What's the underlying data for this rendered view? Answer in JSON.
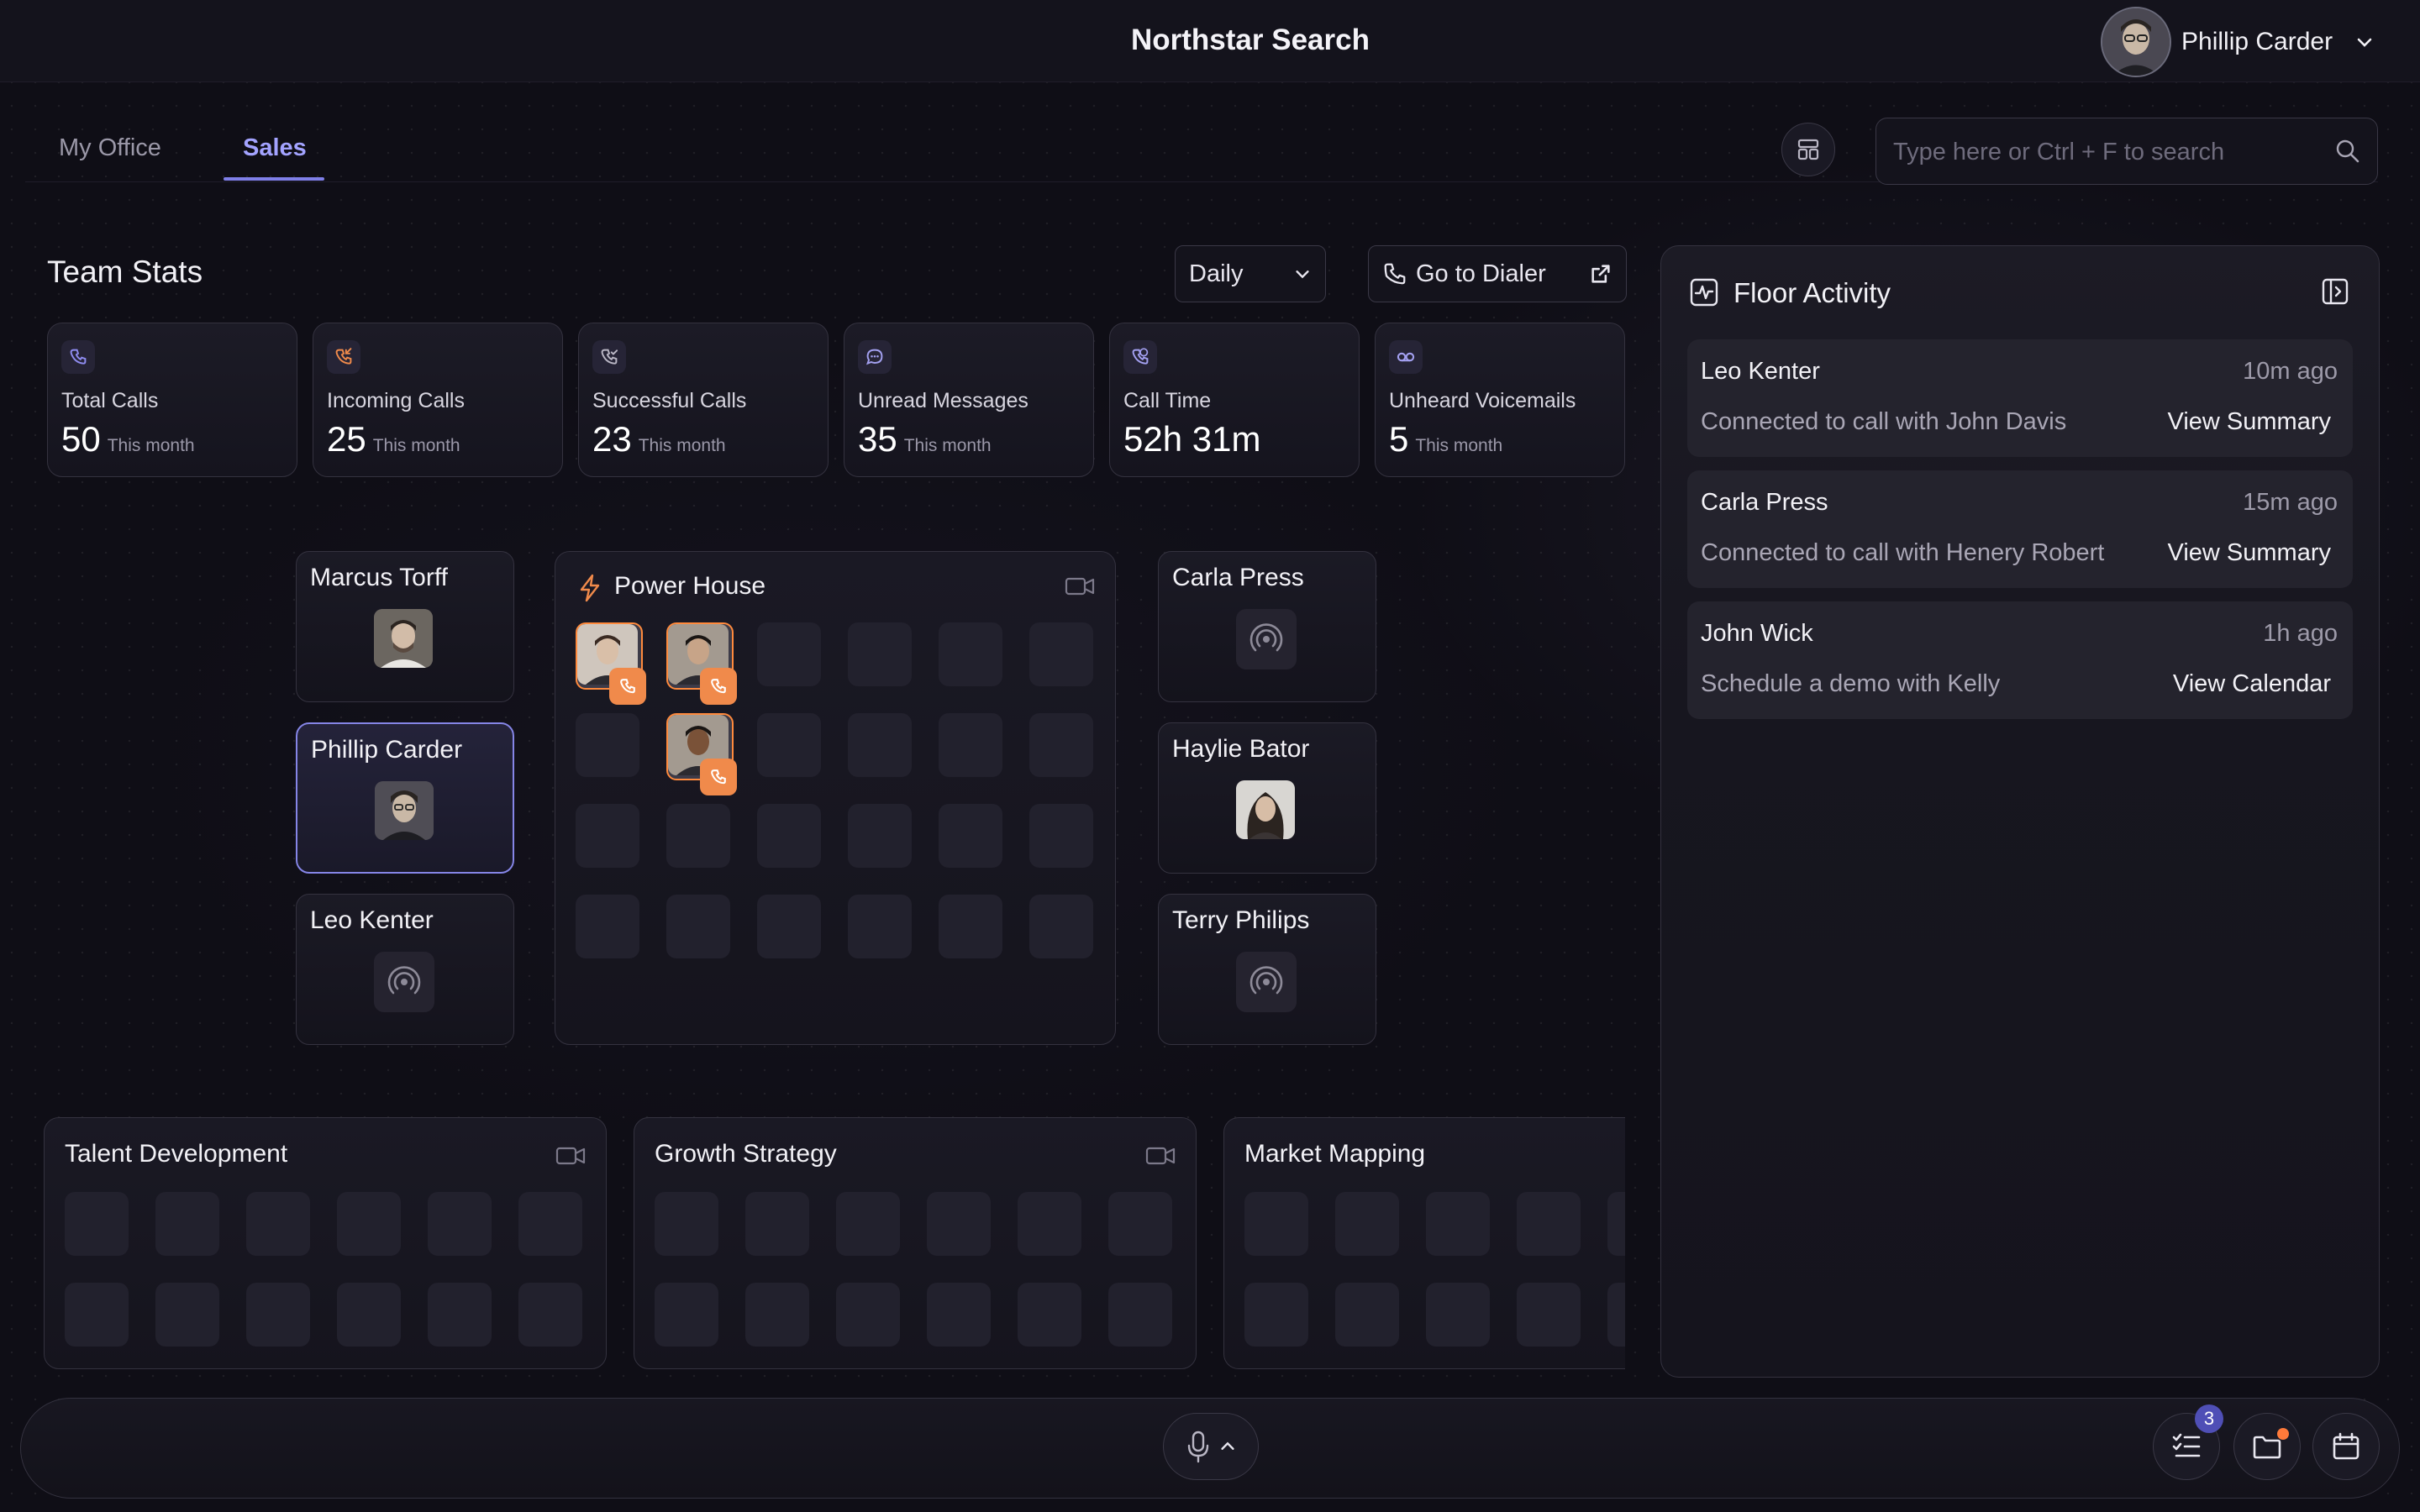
{
  "app": {
    "title": "Northstar Search"
  },
  "user": {
    "name": "Phillip Carder"
  },
  "tabs": [
    {
      "label": "My Office"
    },
    {
      "label": "Sales"
    }
  ],
  "search": {
    "placeholder": "Type here or Ctrl + F to search"
  },
  "team_stats": {
    "title": "Team Stats",
    "period": "Daily",
    "dialer_label": "Go to Dialer",
    "stats": [
      {
        "label": "Total Calls",
        "value": "50",
        "sub": "This month",
        "icon": "phone-icon"
      },
      {
        "label": "Incoming Calls",
        "value": "25",
        "sub": "This month",
        "icon": "incoming-call-icon"
      },
      {
        "label": "Successful Calls",
        "value": "23",
        "sub": "This month",
        "icon": "phone-check-icon"
      },
      {
        "label": "Unread Messages",
        "value": "35",
        "sub": "This month",
        "icon": "message-icon"
      },
      {
        "label": "Call Time",
        "value": "52h 31m",
        "sub": "",
        "icon": "phone-clock-icon"
      },
      {
        "label": "Unheard Voicemails",
        "value": "5",
        "sub": "This month",
        "icon": "voicemail-icon"
      }
    ]
  },
  "office": {
    "people_left": [
      {
        "name": "Marcus Torff"
      },
      {
        "name": "Phillip Carder"
      },
      {
        "name": "Leo Kenter"
      }
    ],
    "people_right": [
      {
        "name": "Carla Press"
      },
      {
        "name": "Haylie Bator"
      },
      {
        "name": "Terry Philips"
      }
    ],
    "power_house": {
      "title": "Power House"
    },
    "rooms": [
      {
        "title": "Talent Development"
      },
      {
        "title": "Growth Strategy"
      },
      {
        "title": "Market Mapping"
      }
    ]
  },
  "floor_activity": {
    "title": "Floor Activity",
    "items": [
      {
        "name": "Leo Kenter",
        "time": "10m ago",
        "desc": "Connected to call with John Davis",
        "link": "View Summary"
      },
      {
        "name": "Carla Press",
        "time": "15m ago",
        "desc": "Connected to call with Henery Robert",
        "link": "View Summary"
      },
      {
        "name": "John Wick",
        "time": "1h ago",
        "desc": "Schedule a demo with Kelly",
        "link": "View Calendar"
      }
    ]
  },
  "bottom_bar": {
    "tasks_badge": "3"
  },
  "colors": {
    "accent": "#7f7fe8",
    "call_orange": "#f08a4b",
    "background": "#0f0e16"
  }
}
